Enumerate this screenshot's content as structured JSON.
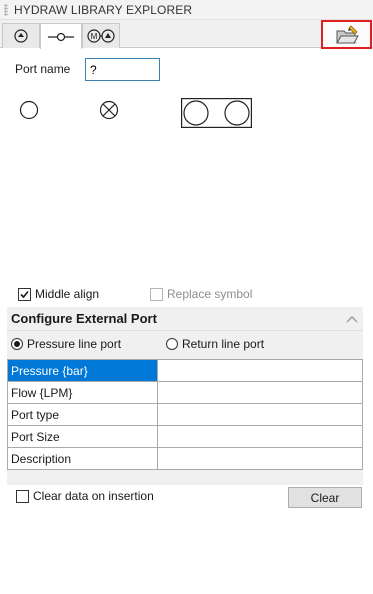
{
  "window": {
    "title": "HYDRAW LIBRARY EXPLORER"
  },
  "tabs": [
    {
      "icon": "circle-arrow-icon"
    },
    {
      "icon": "port-line-icon"
    },
    {
      "icon": "motor-pump-icon"
    }
  ],
  "toolbar": {
    "open_icon": "open-folder-icon"
  },
  "port": {
    "label": "Port name",
    "value": "?"
  },
  "symbols": [
    {
      "icon": "empty-circle-port-icon"
    },
    {
      "icon": "crossed-circle-port-icon"
    },
    {
      "icon": "double-circle-port-icon"
    }
  ],
  "options": {
    "middle_align": {
      "label": "Middle align",
      "checked": true
    },
    "replace_symbol": {
      "label": "Replace symbol",
      "checked": false,
      "disabled": true
    }
  },
  "config": {
    "header": "Configure External Port",
    "radio_pressure": {
      "label": "Pressure line port",
      "selected": true
    },
    "radio_return": {
      "label": "Return line port",
      "selected": false
    },
    "rows": [
      {
        "name": "Pressure {bar}",
        "value": ""
      },
      {
        "name": "Flow {LPM}",
        "value": ""
      },
      {
        "name": "Port type",
        "value": ""
      },
      {
        "name": "Port Size",
        "value": ""
      },
      {
        "name": "Description",
        "value": ""
      }
    ]
  },
  "footer": {
    "clear_on_insert": {
      "label": "Clear data on insertion",
      "checked": false
    },
    "clear_button": "Clear"
  },
  "colors": {
    "selection": "#0078d7",
    "highlight_border": "#e02020"
  }
}
